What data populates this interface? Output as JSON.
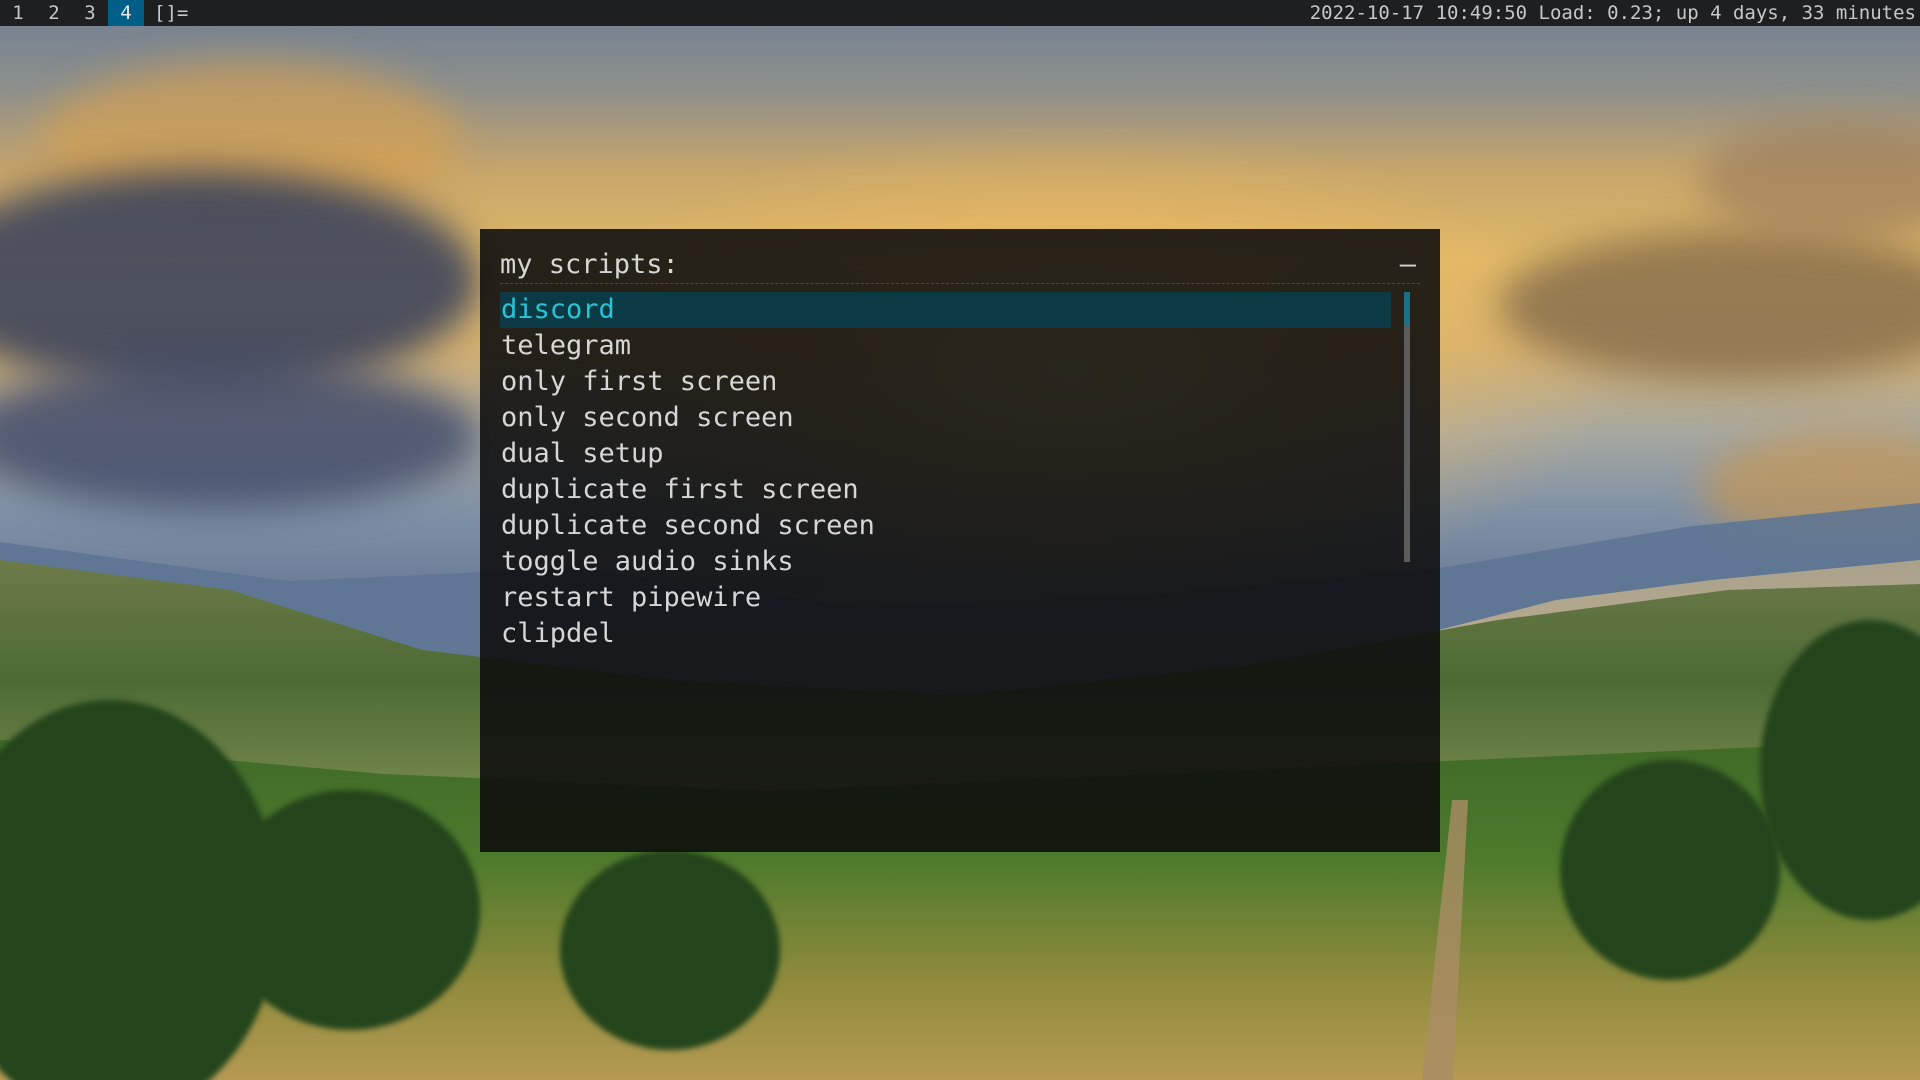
{
  "topbar": {
    "tags": [
      {
        "label": "1",
        "active": false
      },
      {
        "label": "2",
        "active": false
      },
      {
        "label": "3",
        "active": false
      },
      {
        "label": "4",
        "active": true
      }
    ],
    "layout_symbol": "[]=",
    "status": "2022-10-17 10:49:50 Load: 0.23; up 4 days, 33 minutes"
  },
  "menu": {
    "prompt": "my scripts:",
    "mode_indicator": "–",
    "selected_index": 0,
    "items": [
      "discord",
      "telegram",
      "only first screen",
      "only second screen",
      "dual setup",
      "duplicate first screen",
      "duplicate second screen",
      "toggle audio sinks",
      "restart pipewire",
      "clipdel"
    ]
  },
  "colors": {
    "bar_background": "#1d1f21",
    "active_tag": "#005f87",
    "menu_background": "#0c0c0c",
    "selected_background": "#0c3a44",
    "selected_text": "#2ac3d6",
    "text": "#d6d6d6"
  }
}
